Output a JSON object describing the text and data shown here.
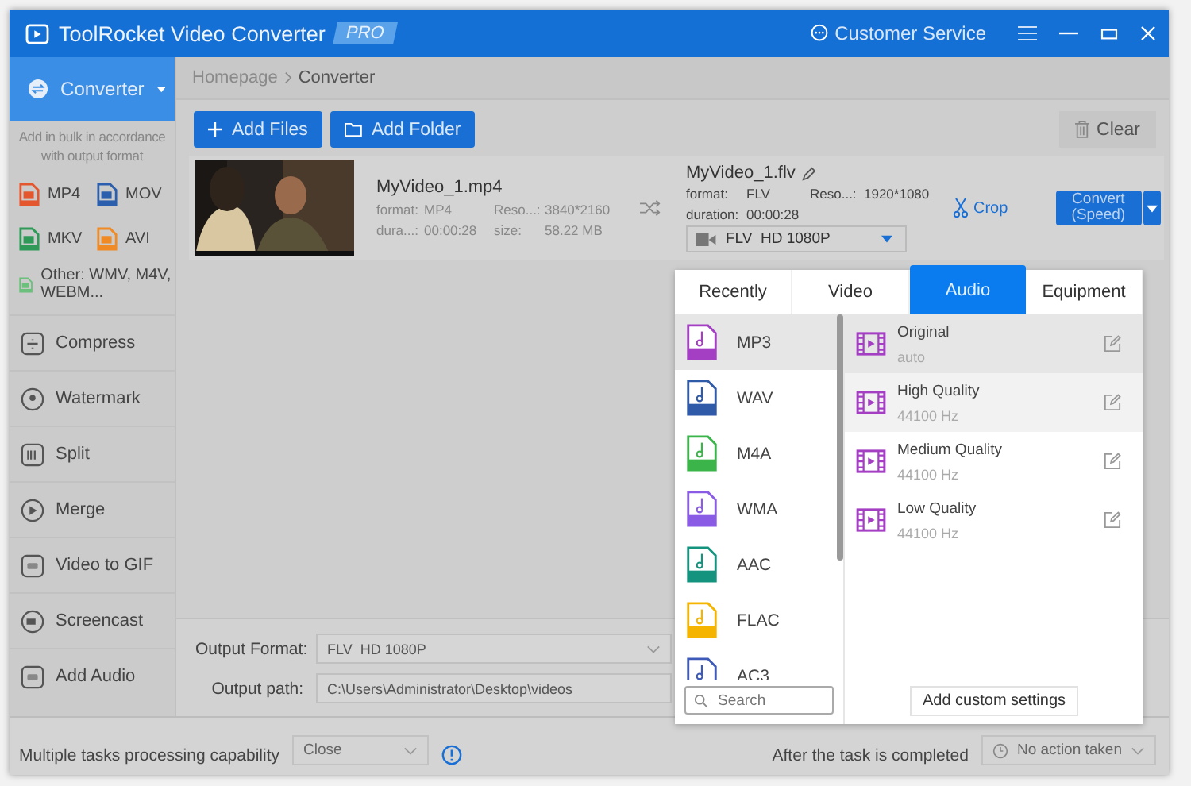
{
  "window": {
    "title": "ToolRocket Video Converter",
    "badge": "PRO",
    "customer_service": "Customer Service"
  },
  "sidebar": {
    "converter": "Converter",
    "hint": "Add in bulk in accordance with output format",
    "formats": [
      {
        "label": "MP4",
        "color": "#e4572e"
      },
      {
        "label": "MOV",
        "color": "#2b5fad"
      },
      {
        "label": "MKV",
        "color": "#2f9a57"
      },
      {
        "label": "AVI",
        "color": "#f08a24"
      },
      {
        "label": "Other: WMV, M4V, WEBM...",
        "color": "#6bc07c"
      }
    ],
    "items": [
      "Compress",
      "Watermark",
      "Split",
      "Merge",
      "Video to GIF",
      "Screencast",
      "Add Audio"
    ]
  },
  "breadcrumb": [
    "Homepage",
    "Converter"
  ],
  "toolbar": {
    "add_files": "Add Files",
    "add_folder": "Add Folder",
    "clear": "Clear"
  },
  "file": {
    "name": "MyVideo_1.mp4",
    "source": [
      {
        "label": "format:",
        "value": "MP4"
      },
      {
        "label": "Reso...:",
        "value": "3840*2160"
      },
      {
        "label": "dura...:",
        "value": "00:00:28"
      },
      {
        "label": "size:",
        "value": "58.22 MB"
      }
    ],
    "target_name": "MyVideo_1.flv",
    "target": [
      {
        "label": "format:",
        "value": "FLV"
      },
      {
        "label": "Reso...:",
        "value": "1920*1080"
      },
      {
        "label": "duration:",
        "value": "00:00:28"
      }
    ],
    "target_format": "FLV  HD 1080P",
    "crop": "Crop",
    "convert": [
      "Convert",
      "(Speed)"
    ]
  },
  "popup": {
    "tabs": [
      {
        "label": "Recently",
        "selected": false
      },
      {
        "label": "Video",
        "selected": false
      },
      {
        "label": "Audio",
        "selected": true
      },
      {
        "label": "Equipment",
        "selected": false
      }
    ],
    "formats": [
      {
        "label": "MP3",
        "color": "#a43fc4",
        "selected": true
      },
      {
        "label": "WAV",
        "color": "#2f5aa8",
        "selected": false
      },
      {
        "label": "M4A",
        "color": "#3bb54a",
        "selected": false
      },
      {
        "label": "WMA",
        "color": "#8a5ce6",
        "selected": false
      },
      {
        "label": "AAC",
        "color": "#14937f",
        "selected": false
      },
      {
        "label": "FLAC",
        "color": "#f5b400",
        "selected": false
      },
      {
        "label": "AC3",
        "color": "#3d5ab8",
        "selected": false
      }
    ],
    "presets": [
      {
        "name": "Original",
        "detail": "auto",
        "selected": true,
        "hovered": false
      },
      {
        "name": "High Quality",
        "detail": "44100 Hz",
        "selected": false,
        "hovered": true
      },
      {
        "name": "Medium Quality",
        "detail": "44100 Hz",
        "selected": false,
        "hovered": false
      },
      {
        "name": "Low Quality",
        "detail": "44100 Hz",
        "selected": false,
        "hovered": false
      }
    ],
    "search_placeholder": "Search",
    "add_custom": "Add custom settings"
  },
  "output": {
    "format_label": "Output Format:",
    "format_value": "FLV  HD 1080P",
    "path_label": "Output path:",
    "path_value": "C:\\Users\\Administrator\\Desktop\\videos"
  },
  "footer": {
    "multi_label": "Multiple tasks processing capability",
    "multi_value": "Close",
    "after_label": "After the task is completed",
    "after_value": "No action taken"
  }
}
